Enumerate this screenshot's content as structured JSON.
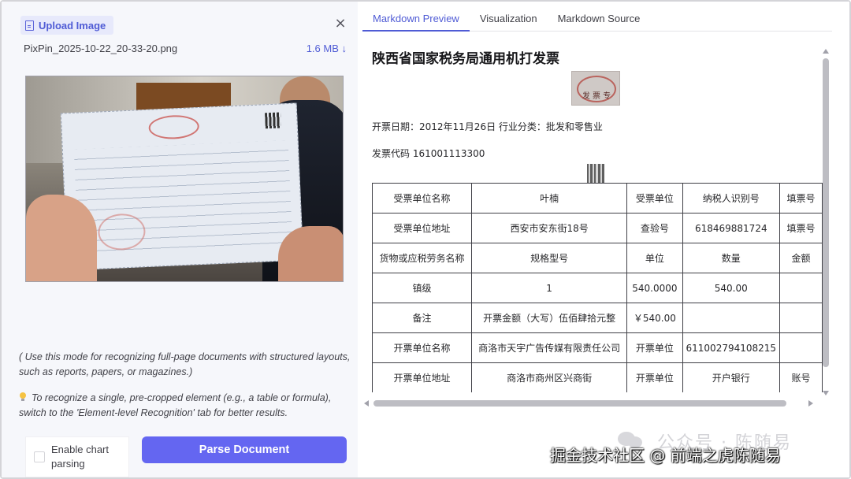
{
  "upload": {
    "label": "Upload Image",
    "close_glyph": "×",
    "file_name": "PixPin_2025-10-22_20-33-20.png",
    "file_size": "1.6 MB ↓"
  },
  "notes": {
    "mode_note": "( Use this mode for recognizing full-page documents with structured layouts, such as reports, papers, or magazines.)",
    "tip": "To recognize a single, pre-cropped element (e.g., a table or formula), switch to the 'Element-level Recognition' tab for better results."
  },
  "controls": {
    "chart_parsing_label": "Enable chart parsing",
    "parse_button": "Parse Document"
  },
  "tabs": [
    {
      "label": "Markdown Preview",
      "active": true
    },
    {
      "label": "Visualization",
      "active": false
    },
    {
      "label": "Markdown Source",
      "active": false
    }
  ],
  "document": {
    "title": "陕西省国家税务局通用机打发票",
    "seal_text": "发 票 专",
    "line1": "开票日期：2012年11月26日 行业分类：批发和零售业",
    "line2": "发票代码 161001113300",
    "table": [
      [
        "受票单位名称",
        "叶楠",
        "受票单位",
        "纳税人识别号",
        "填票号"
      ],
      [
        "受票单位地址",
        "西安市安东街18号",
        "查验号",
        "618469881724",
        "填票号"
      ],
      [
        "货物或应税劳务名称",
        "规格型号",
        "单位",
        "数量",
        "金额"
      ],
      [
        "镇级",
        "1",
        "540.0000",
        "540.00",
        ""
      ],
      [
        "备注",
        "开票金额（大写）伍佰肆拾元整",
        "￥540.00",
        "",
        ""
      ],
      [
        "开票单位名称",
        "商洛市天宇广告传媒有限责任公司",
        "开票单位",
        "611002794108215",
        ""
      ],
      [
        "开票单位地址",
        "商洛市商州区兴商街",
        "开票单位",
        "开户银行",
        "账号"
      ]
    ]
  },
  "watermark": {
    "line1": "公众号 · 陈随易",
    "line2": "掘金技术社区 @ 前端之虎陈随易"
  }
}
